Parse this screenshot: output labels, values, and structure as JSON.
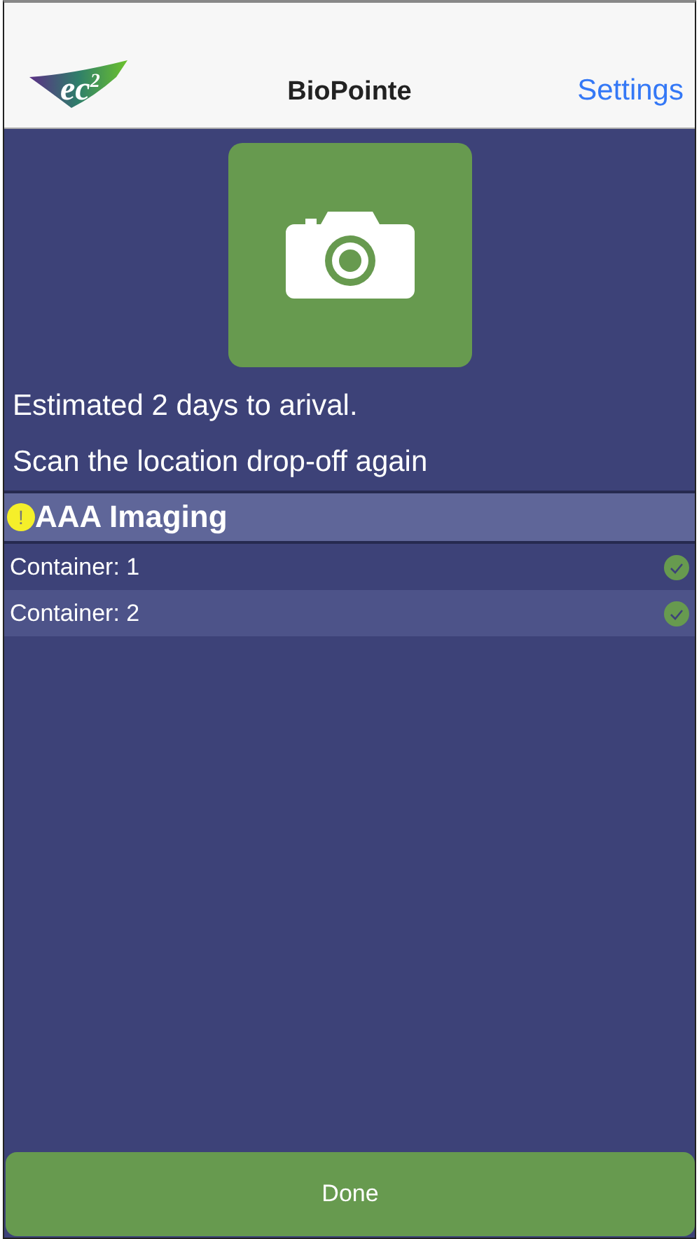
{
  "nav_bar": {
    "logo": "ec$^{2}$",
    "title": "BioPointe",
    "settings": "Settings"
  },
  "messages": [
    "Estimated 2 days to arival.",
    "Scan the location drop-off again"
  ],
  "group": {
    "title": "AAA Imaging",
    "warning": true,
    "warning_mark": "!",
    "containers": [
      {
        "label": "Container: 1",
        "checked": true
      },
      {
        "label": "Container: 2",
        "checked": true
      }
    ]
  },
  "done_button": "Done"
}
